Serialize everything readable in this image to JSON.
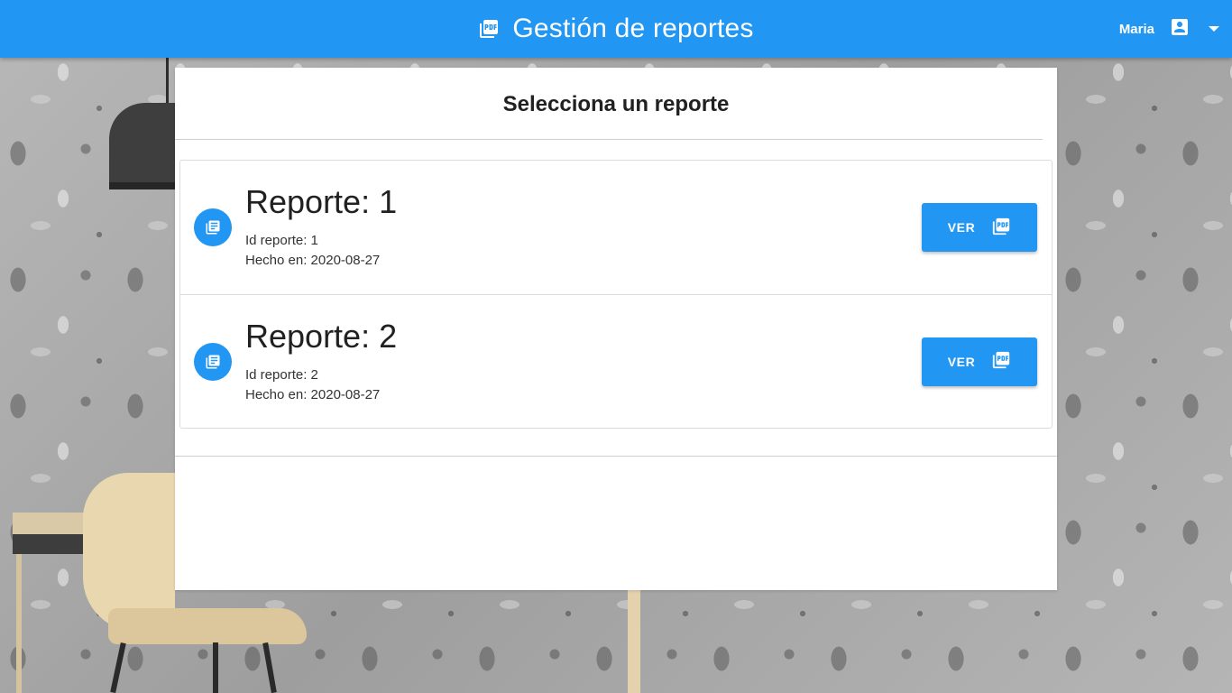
{
  "appbar": {
    "title": "Gestión de reportes",
    "title_icon": "pdf-icon",
    "user_name": "Maria",
    "user_icon": "account-box-icon",
    "menu_icon": "caret-down-icon",
    "color": "#2196f3"
  },
  "panel": {
    "title": "Selecciona un reporte"
  },
  "reports": [
    {
      "title": "Reporte: 1",
      "id_line": "Id reporte: 1",
      "date_line": "Hecho en: 2020-08-27",
      "icon": "library-books-icon",
      "button_label": "VER",
      "button_icon": "pdf-icon"
    },
    {
      "title": "Reporte: 2",
      "id_line": "Id reporte: 2",
      "date_line": "Hecho en: 2020-08-27",
      "icon": "library-books-icon",
      "button_label": "VER",
      "button_icon": "pdf-icon"
    }
  ]
}
